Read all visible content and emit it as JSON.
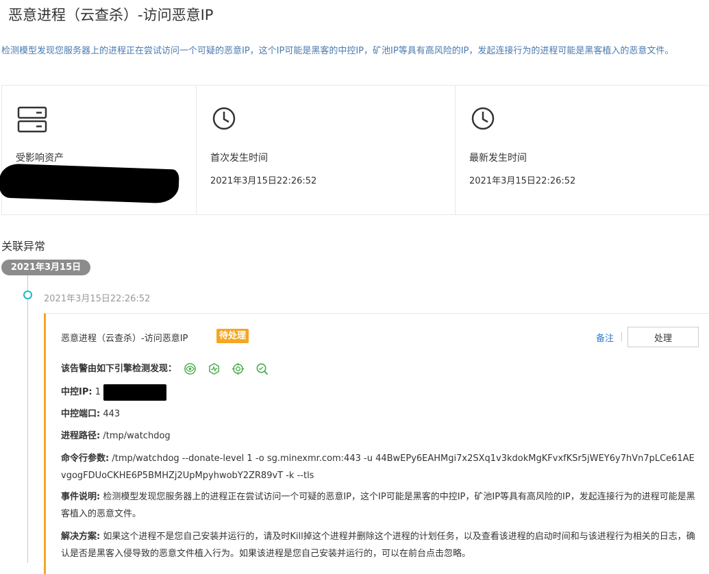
{
  "page": {
    "title": "恶意进程（云查杀）-访问恶意IP",
    "description": "检测模型发现您服务器上的进程正在尝试访问一个可疑的恶意IP，这个IP可能是黑客的中控IP，矿池IP等具有高风险的IP，发起连接行为的进程可能是黑客植入的恶意文件。"
  },
  "cards": {
    "asset": {
      "label": "受影响资产",
      "icon": "server-icon"
    },
    "first": {
      "label": "首次发生时间",
      "value": "2021年3月15日22:26:52",
      "icon": "clock-icon"
    },
    "latest": {
      "label": "最新发生时间",
      "value": "2021年3月15日22:26:52",
      "icon": "clock-icon"
    }
  },
  "related": {
    "title": "关联异常",
    "date": "2021年3月15日",
    "time": "2021年3月15日22:26:52"
  },
  "event": {
    "title": "恶意进程（云查杀）-访问恶意IP",
    "status": "待处理",
    "note_label": "备注",
    "handle_label": "处理",
    "engines_label": "该告警由如下引擎检测发现：",
    "engines": [
      "engine-1-icon",
      "engine-2-icon",
      "engine-3-icon",
      "engine-4-icon"
    ],
    "c2ip_label": "中控IP:",
    "c2ip_value": "1",
    "c2port_label": "中控端口:",
    "c2port_value": "443",
    "path_label": "进程路径:",
    "path_value": "/tmp/watchdog",
    "cmd_label": "命令行参数:",
    "cmd_value": "/tmp/watchdog --donate-level 1 -o sg.minexmr.com:443 -u 44BwEPy6EAHMgi7x2SXq1v3kdokMgKFvxfKSr5jWEY6y7hVn7pLCe61AEvgogFDUoCKHE6P5BMHZj2UpMpyhwobY2ZR89vT -k --tls",
    "event_label": "事件说明:",
    "event_value": "检测模型发现您服务器上的进程正在尝试访问一个可疑的恶意IP，这个IP可能是黑客的中控IP，矿池IP等具有高风险的IP，发起连接行为的进程可能是黑客植入的恶意文件。",
    "solution_label": "解决方案:",
    "solution_value": "如果这个进程不是您自己安装并运行的，请及时Kill掉这个进程并删除这个进程的计划任务，以及查看该进程的启动时间和与该进程行为相关的日志，确认是否是黑客入侵导致的恶意文件植入行为。如果该进程是您自己安装并运行的，可以在前台点击忽略。"
  },
  "colors": {
    "accent": "#f5a623",
    "link": "#2d7bd8",
    "engine": "#4caf50",
    "timeline_dot": "#1fb9c6"
  }
}
